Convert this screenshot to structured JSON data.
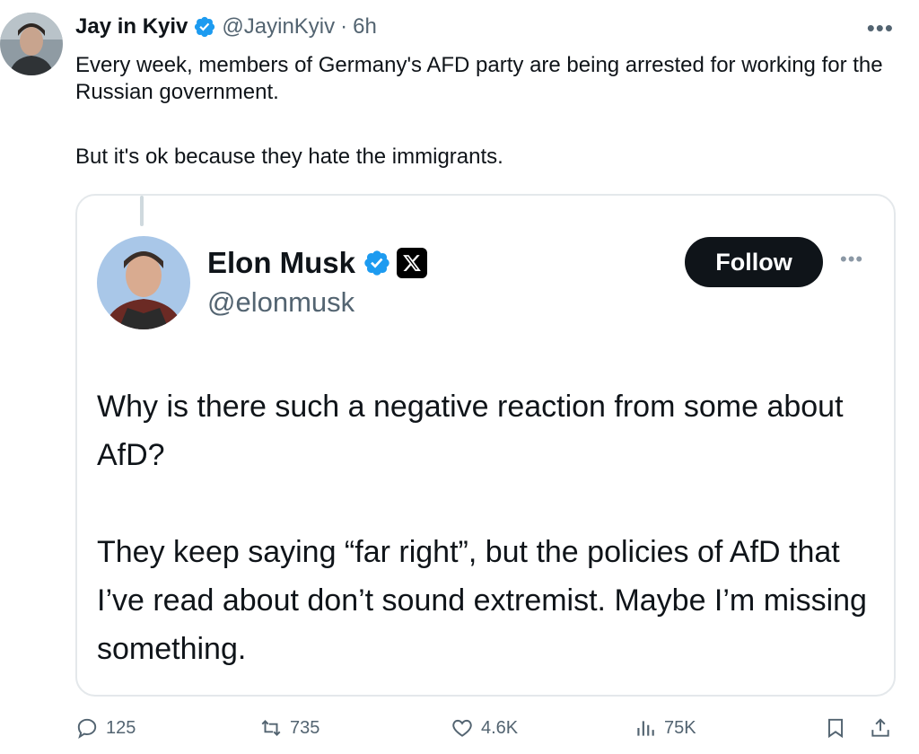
{
  "tweet": {
    "author_name": "Jay in Kyiv",
    "handle": "@JayinKyiv",
    "separator": "·",
    "time": "6h",
    "text_line1": "Every week, members of Germany's AFD party are being arrested for working for the Russian government.",
    "text_line2": "But it's ok because they hate the immigrants."
  },
  "quote": {
    "author_name": "Elon Musk",
    "handle": "@elonmusk",
    "follow_label": "Follow",
    "paragraph1": "Why is there such a negative reaction from some about AfD?",
    "paragraph2": "They keep saying “far right”, but the policies of AfD that I’ve read about don’t sound extremist. Maybe I’m missing something."
  },
  "actions": {
    "replies": "125",
    "reposts": "735",
    "likes": "4.6K",
    "views": "75K"
  },
  "colors": {
    "verified_blue": "#1d9bf0",
    "muted_text": "#536471",
    "border": "#e4e8eb"
  },
  "icons": [
    "verified-badge-icon",
    "more-icon",
    "x-logo-icon",
    "reply-icon",
    "repost-icon",
    "like-icon",
    "views-icon",
    "bookmark-icon",
    "share-icon"
  ]
}
